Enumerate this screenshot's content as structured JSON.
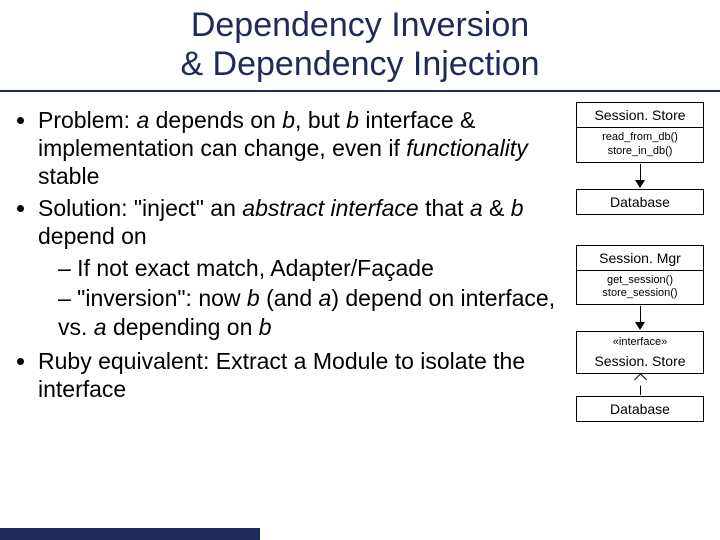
{
  "title_line1": "Dependency Inversion",
  "title_line2": "& Dependency Injection",
  "bullets": {
    "b1_pre": "Problem: ",
    "b1_a": "a",
    "b1_mid1": " depends on ",
    "b1_b1": "b",
    "b1_mid2": ", but ",
    "b1_b2": "b",
    "b1_mid3": " interface & implementation can change, even if ",
    "b1_func": "functionality",
    "b1_end": " stable",
    "b2_pre": "Solution: \"inject\" an ",
    "b2_abs": "abstract interface",
    "b2_mid": " that ",
    "b2_a": "a",
    "b2_amp": " & ",
    "b2_b": "b",
    "b2_end": " depend on",
    "s1": "– If not exact match, Adapter/Façade",
    "s2_pre": "– \"inversion\": now ",
    "s2_b": "b",
    "s2_mid1": " (and ",
    "s2_a": "a",
    "s2_mid2": ") depend on interface, vs. ",
    "s2_a2": "a",
    "s2_mid3": " depending on ",
    "s2_b2": "b",
    "b3": "Ruby equivalent: Extract a Module to isolate the interface"
  },
  "diagram": {
    "box1": "Session. Store",
    "box1_m1": "read_from_db()",
    "box1_m2": "store_in_db()",
    "box2": "Database",
    "box3": "Session. Mgr",
    "box3_m1": "get_session()",
    "box3_m2": "store_session()",
    "box4_stereo": "«interface»",
    "box4": "Session. Store",
    "box5": "Database"
  }
}
